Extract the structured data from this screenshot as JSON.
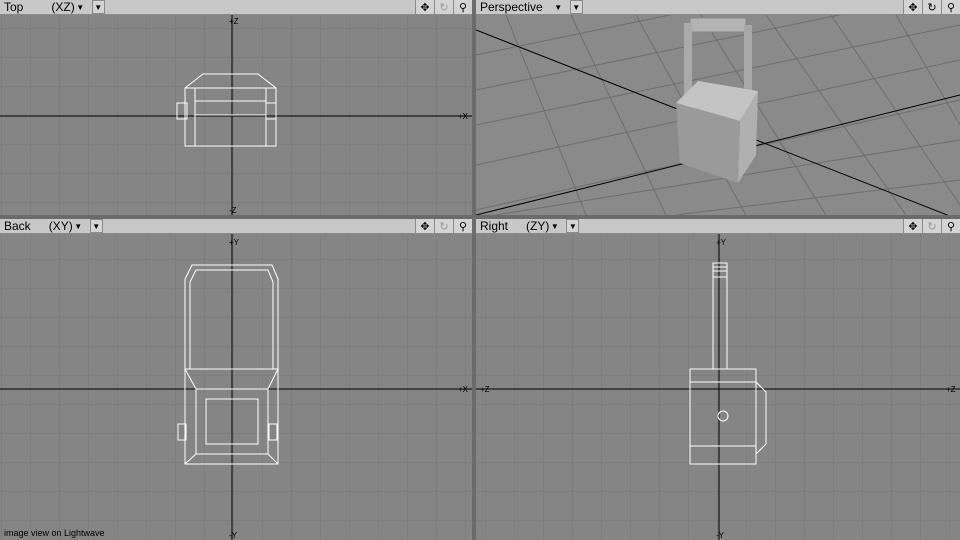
{
  "viewports": {
    "top": {
      "name": "Top",
      "axis": "(XZ)",
      "axis_x_label": "+X",
      "axis_up_label": "+Z",
      "axis_down_label": "-Z"
    },
    "perspective": {
      "name": "Perspective"
    },
    "back": {
      "name": "Back",
      "axis": "(XY)",
      "axis_x_label": "+X",
      "axis_up_label": "+Y",
      "axis_down_label": "-Y"
    },
    "right": {
      "name": "Right",
      "axis": "(ZY)",
      "axis_left_label": "+Z",
      "axis_right_label": "+Z",
      "axis_up_label": "+Y",
      "axis_down_label": "-Y"
    }
  },
  "tools": {
    "move": "move-icon",
    "rotate": "rotate-icon",
    "zoom": "zoom-icon"
  },
  "caption": "image view on Lightwave",
  "colors": {
    "viewport_bg": "#858585",
    "grid": "#7a7a7a",
    "axis": "#000000",
    "wire": "#ffffff",
    "header": "#c8c8c8"
  }
}
